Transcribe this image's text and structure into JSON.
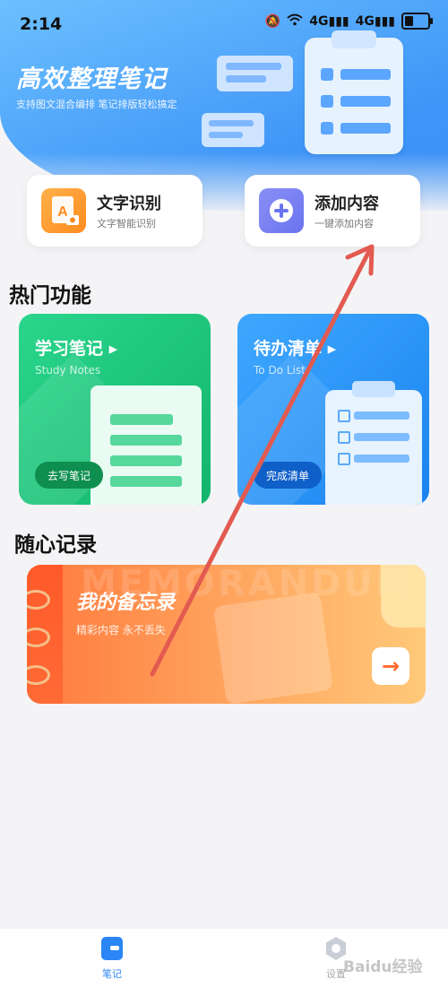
{
  "status_bar": {
    "time": "2:14",
    "network_1": "4G",
    "network_2": "4G"
  },
  "header": {
    "title": "高效整理笔记",
    "subtitle": "支持图文混合编排 笔记排版轻松搞定"
  },
  "quick_actions": [
    {
      "title": "文字识别",
      "subtitle": "文字智能识别",
      "icon": "text-ocr-icon",
      "color": "#ff9f2e"
    },
    {
      "title": "添加内容",
      "subtitle": "一键添加内容",
      "icon": "plus-circle-icon",
      "color": "#6b74f0"
    }
  ],
  "hot_section": {
    "title": "热门功能",
    "cards": [
      {
        "title": "学习笔记",
        "english": "Study Notes",
        "action": "去写笔记",
        "color": "#19c27a"
      },
      {
        "title": "待办清单",
        "english": "To Do List",
        "action": "完成清单",
        "color": "#2d8ff5"
      }
    ]
  },
  "free_section": {
    "title": "随心记录",
    "memo": {
      "background_text": "MEMORANDUM",
      "title": "我的备忘录",
      "subtitle": "精彩内容 永不丢失",
      "arrow_icon": "arrow-right-icon"
    }
  },
  "bottom_nav": [
    {
      "label": "笔记",
      "icon": "note-icon",
      "active": true
    },
    {
      "label": "设置",
      "icon": "settings-gear-icon",
      "active": false
    }
  ],
  "watermark": "Baidu经验",
  "colors": {
    "primary": "#3f95f7",
    "annotation_arrow": "#e25a50"
  }
}
